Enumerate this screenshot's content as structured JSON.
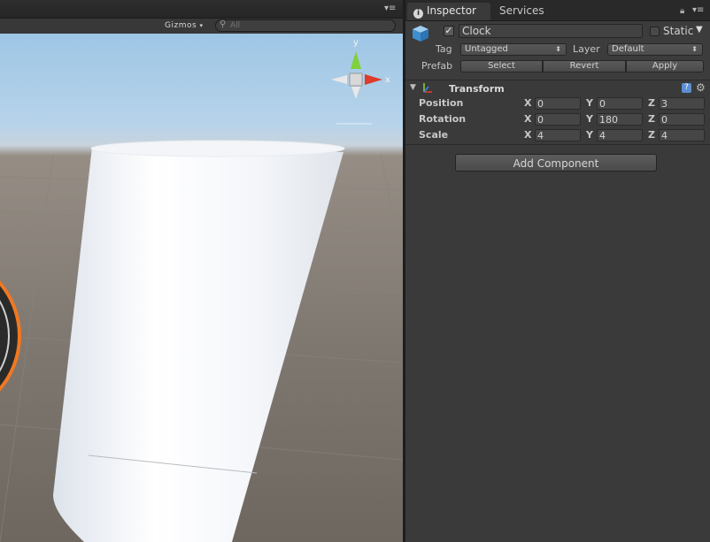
{
  "scene": {
    "gizmos_label": "Gizmos",
    "search_placeholder": "All",
    "gizmo_axes": {
      "y": "y",
      "x": "x"
    }
  },
  "inspector": {
    "tabs": [
      {
        "label": "Inspector",
        "active": true
      },
      {
        "label": "Services",
        "active": false
      }
    ],
    "gameobject": {
      "active": true,
      "name": "Clock",
      "static_label": "Static",
      "static": false,
      "tag_label": "Tag",
      "tag_value": "Untagged",
      "layer_label": "Layer",
      "layer_value": "Default",
      "prefab_label": "Prefab",
      "prefab_buttons": [
        "Select",
        "Revert",
        "Apply"
      ]
    },
    "transform": {
      "title": "Transform",
      "rows": [
        {
          "label": "Position",
          "x": "0",
          "y": "0",
          "z": "3"
        },
        {
          "label": "Rotation",
          "x": "0",
          "y": "180",
          "z": "0"
        },
        {
          "label": "Scale",
          "x": "4",
          "y": "4",
          "z": "4"
        }
      ],
      "axis_labels": [
        "X",
        "Y",
        "Z"
      ]
    },
    "add_component_label": "Add Component"
  },
  "colors": {
    "panel_bg": "#3a3a3a",
    "gizmo_y": "#7fd13a",
    "gizmo_x": "#e03a2a",
    "clock_ring": "#f07820"
  }
}
